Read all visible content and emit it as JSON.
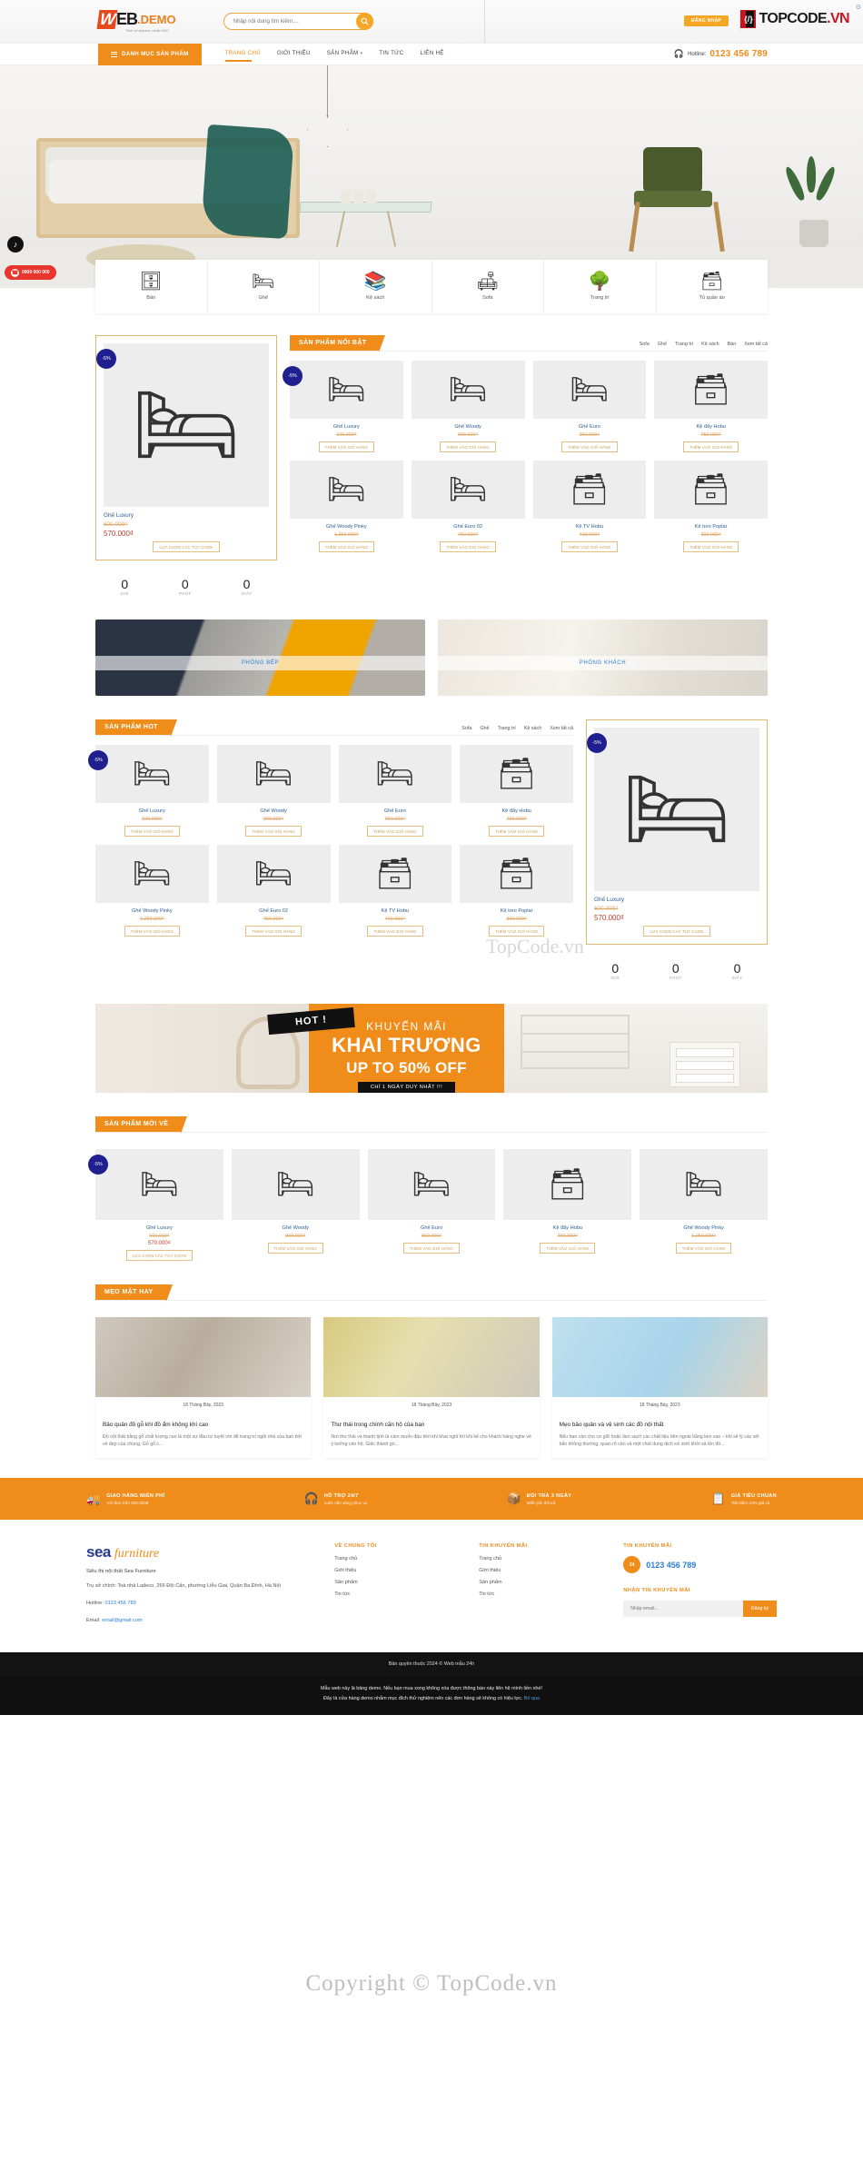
{
  "header": {
    "logo_w": "W",
    "logo_eb": "EB",
    "logo_demo": ".DEMO",
    "logo_sub": "Thiết kế website chuẩn SEO",
    "search_placeholder": "Nhập nội dung tìm kiếm....",
    "search_value": "",
    "login_label": "ĐĂNG NHẬP",
    "partner_brand_mark": "{/}",
    "partner_brand_black": "TOPCODE",
    "partner_brand_red": ".VN"
  },
  "nav": {
    "category_button": "DANH MỤC SẢN PHẨM",
    "links": [
      {
        "label": "TRANG CHỦ",
        "active": true,
        "caret": false
      },
      {
        "label": "GIỚI THIỆU",
        "active": false,
        "caret": false
      },
      {
        "label": "SẢN PHẨM",
        "active": false,
        "caret": true
      },
      {
        "label": "TIN TỨC",
        "active": false,
        "caret": false
      },
      {
        "label": "LIÊN HỆ",
        "active": false,
        "caret": false
      }
    ],
    "hotline_label": "Hotline:",
    "hotline_number": "0123 456 789"
  },
  "side_widgets": {
    "tiktok_icon": "tiktok-icon",
    "phone_number": "0909 000 000"
  },
  "categories": [
    {
      "label": "Bàn",
      "icon": "table-icon",
      "glyph": "🪑"
    },
    {
      "label": "Ghế",
      "icon": "chair-icon",
      "glyph": "🪑"
    },
    {
      "label": "Kệ sách",
      "icon": "bookshelf-icon",
      "glyph": "📚"
    },
    {
      "label": "Sofa",
      "icon": "sofa-icon",
      "glyph": "🛋"
    },
    {
      "label": "Trang trí",
      "icon": "lamp-icon",
      "glyph": "🪴"
    },
    {
      "label": "Tủ quần áo",
      "icon": "wardrobe-icon",
      "glyph": "🚪"
    }
  ],
  "featured_section": {
    "title": "SẢN PHẨM NỔI BẬT",
    "tabs": [
      "Sofa",
      "Ghế",
      "Trang trí",
      "Kệ sách",
      "Bàn",
      "Xem tất cả"
    ],
    "spotlight": {
      "badge": "-5%",
      "name": "Ghế Luxury",
      "old_price": "600.000₫",
      "new_price": "570.000₫",
      "button": "LỰA CHỌN CÁC TÙY CHỌN",
      "glyph": "🪑"
    },
    "countdown": [
      {
        "value": "0",
        "unit": "GIỜ"
      },
      {
        "value": "0",
        "unit": "PHÚT"
      },
      {
        "value": "0",
        "unit": "GIÂY"
      }
    ],
    "products": [
      {
        "name": "Ghế Luxury",
        "price": "600.000₫",
        "badge": "-5%",
        "button": "THÊM VÀO GIỎ HÀNG",
        "glyph": "🪑"
      },
      {
        "name": "Ghế Woody",
        "price": "900.000₫",
        "badge": "",
        "button": "THÊM VÀO GIỎ HÀNG",
        "glyph": "🪑"
      },
      {
        "name": "Ghế Euro",
        "price": "960.000₫",
        "badge": "",
        "button": "THÊM VÀO GIỎ HÀNG",
        "glyph": "🪑"
      },
      {
        "name": "Kệ đẩy Hobu",
        "price": "750.000₫",
        "badge": "",
        "button": "THÊM VÀO GIỎ HÀNG",
        "glyph": "🗄"
      },
      {
        "name": "Ghế Woody Pinky",
        "price": "1.250.000₫",
        "badge": "",
        "button": "THÊM VÀO GIỎ HÀNG",
        "glyph": "🪑"
      },
      {
        "name": "Ghế Euro 02",
        "price": "750.000₫",
        "badge": "",
        "button": "THÊM VÀO GIỎ HÀNG",
        "glyph": "🪑"
      },
      {
        "name": "Kệ TV Hobu",
        "price": "400.000₫",
        "badge": "",
        "button": "THÊM VÀO GIỎ HÀNG",
        "glyph": "🗄"
      },
      {
        "name": "Kệ treo Poplar",
        "price": "300.000₫",
        "badge": "",
        "button": "THÊM VÀO GIỎ HÀNG",
        "glyph": "🗄"
      }
    ]
  },
  "rooms": [
    {
      "label": "PHÒNG BẾP",
      "key": "kitchen"
    },
    {
      "label": "PHÒNG KHÁCH",
      "key": "living"
    }
  ],
  "hot_section": {
    "title": "SẢN PHẨM HOT",
    "tabs": [
      "Sofa",
      "Ghế",
      "Trang trí",
      "Kệ sách",
      "Xem tất cả"
    ],
    "spotlight": {
      "badge": "-5%",
      "name": "Ghế Luxury",
      "old_price": "600.000₫",
      "new_price": "570.000₫",
      "button": "LỰA CHỌN CÁC TÙY CHỌN",
      "glyph": "🪑"
    },
    "countdown": [
      {
        "value": "0",
        "unit": "GIỜ"
      },
      {
        "value": "0",
        "unit": "PHÚT"
      },
      {
        "value": "0",
        "unit": "GIÂY"
      }
    ],
    "products": [
      {
        "name": "Ghế Luxury",
        "price": "600.000₫",
        "badge": "-5%",
        "button": "THÊM VÀO GIỎ HÀNG",
        "glyph": "🪑"
      },
      {
        "name": "Ghế Woody",
        "price": "900.000₫",
        "badge": "",
        "button": "THÊM VÀO GIỎ HÀNG",
        "glyph": "🪑"
      },
      {
        "name": "Ghế Euro",
        "price": "960.000₫",
        "badge": "",
        "button": "THÊM VÀO GIỎ HÀNG",
        "glyph": "🪑"
      },
      {
        "name": "Kệ đẩy Hobu",
        "price": "750.000₫",
        "badge": "",
        "button": "THÊM VÀO GIỎ HÀNG",
        "glyph": "🗄"
      },
      {
        "name": "Ghế Woody Pinky",
        "price": "1.250.000₫",
        "badge": "",
        "button": "THÊM VÀO GIỎ HÀNG",
        "glyph": "🪑"
      },
      {
        "name": "Ghế Euro 02",
        "price": "750.000₫",
        "badge": "",
        "button": "THÊM VÀO GIỎ HÀNG",
        "glyph": "🪑"
      },
      {
        "name": "Kệ TV Hobu",
        "price": "400.000₫",
        "badge": "",
        "button": "THÊM VÀO GIỎ HÀNG",
        "glyph": "🗄"
      },
      {
        "name": "Kệ treo Poplar",
        "price": "300.000₫",
        "badge": "",
        "button": "THÊM VÀO GIỎ HÀNG",
        "glyph": "🗄"
      }
    ]
  },
  "promo_banner": {
    "hot_tag": "HOT !",
    "line1": "KHUYẾN MÃI",
    "line2": "KHAI TRƯƠNG",
    "line3": "UP TO 50% OFF",
    "line4": "CHỈ 1 NGÀY DUY NHẤT !!!"
  },
  "new_section": {
    "title": "SẢN PHẨM MỚI VỀ",
    "products": [
      {
        "name": "Ghế Luxury",
        "old_price": "600.000₫",
        "new_price": "570.000₫",
        "badge": "-5%",
        "button": "LỰA CHỌN CÁC TÙY CHỌN",
        "glyph": "🪑"
      },
      {
        "name": "Ghế Woody",
        "old_price": "",
        "new_price": "900.000₫",
        "badge": "",
        "button": "THÊM VÀO GIỎ HÀNG",
        "glyph": "🪑"
      },
      {
        "name": "Ghế Euro",
        "old_price": "",
        "new_price": "960.000₫",
        "badge": "",
        "button": "THÊM VÀO GIỎ HÀNG",
        "glyph": "🪑"
      },
      {
        "name": "Kệ đẩy Hobu",
        "old_price": "",
        "new_price": "750.000₫",
        "badge": "",
        "button": "THÊM VÀO GIỎ HÀNG",
        "glyph": "🗄"
      },
      {
        "name": "Ghế Woody Pinky",
        "old_price": "",
        "new_price": "1.250.000₫",
        "badge": "",
        "button": "THÊM VÀO GIỎ HÀNG",
        "glyph": "🪑"
      }
    ]
  },
  "blog_section": {
    "title": "MẸO MẶT HAY",
    "posts": [
      {
        "date": "18 Tháng Bảy, 2023",
        "title": "Bảo quản đồ gỗ khi đồ ẩm không khí cao",
        "excerpt": "Đồ nội thất bằng gỗ chất lượng cao là một sự đầu tư tuyệt vời để trang trí ngôi nhà của bạn bởi vẻ đẹp của chúng. Gỗ gỗ c..."
      },
      {
        "date": "18 Tháng Bảy, 2023",
        "title": "Thư thái trong chính căn hộ của bạn",
        "excerpt": "Nơi thư thái và thanh tịnh là cảm muốn đầu tiên khi khai nghĩ tới khi kể cho khách hàng nghe về ý tưởng cản hộ. Giấc thành gri..."
      },
      {
        "date": "18 Tháng Bảy, 2023",
        "title": "Mẹo bảo quản và vệ sinh các đồ nội thất",
        "excerpt": "Nếu bạn cần cho cơ giữ hoặc làm sạch các chất liệu bên ngoài bằng ken xao – khi sẽ lý các vết bẩn không thường, quan rõ cần và một chút dung dịch xử sinh khởi xả lên đồ..."
      }
    ]
  },
  "services": [
    {
      "icon": "truck-icon",
      "glyph": "🚚",
      "title": "GIAO HÀNG MIỄN PHÍ",
      "sub": "Với đơn trên 300.000đ"
    },
    {
      "icon": "headset-icon",
      "glyph": "🎧",
      "title": "HỖ TRỢ 24/7",
      "sub": "Luôn sẵn sàng phục vụ"
    },
    {
      "icon": "box-icon",
      "glyph": "📦",
      "title": "ĐỔI TRẢ 3 NGÀY",
      "sub": "Miễn phí đổi trả"
    },
    {
      "icon": "clipboard-icon",
      "glyph": "📋",
      "title": "GIÁ TIÊU CHUẨN",
      "sub": "Tiết kiệm 10% giá cả"
    }
  ],
  "footer": {
    "brand_sea": "sea",
    "brand_furniture": "furniture",
    "tagline": "Siêu thị nội thất Sea Furniture",
    "address": "Trụ sở chính: Toà nhà Ladeco, 266 Đội Cấn, phường Liễu Giai, Quận Ba Đình, Hà Nội",
    "hotline_label": "Hotline:",
    "hotline_value": "0123 456 789",
    "email_label": "Email:",
    "email_value": "email@gmail.com",
    "col2_heading": "VỀ CHÚNG TÔI",
    "col2_items": [
      "Trang chủ",
      "Giới thiệu",
      "Sản phẩm",
      "Tin tức"
    ],
    "col3_heading": "TIN KHUYẾN MÃI",
    "col3_items": [
      "Trang chủ",
      "Giới thiệu",
      "Sản phẩm",
      "Tin tức"
    ],
    "col4_heading": "TIN KHUYẾN MÃI",
    "col4_badge": "24",
    "col4_phone": "0123 456 789",
    "newsletter_heading": "NHẬN TIN KHUYẾN MÃI",
    "newsletter_placeholder": "Nhập email...",
    "newsletter_value": "",
    "newsletter_button": "Đăng ký"
  },
  "bottom": {
    "copyright": "Bản quyền thuộc 2024 © Web mẫu 24h",
    "demo_line1": "Mẫu web này là bảng demo. Nếu bạn mua xong không xóa được thông báo này liên hệ mình liền nhé!",
    "demo_line2": "Đây là cửa hàng demo nhằm mục đích thử nghiệm nên các đơn hàng sẽ không có hiệu lực.",
    "demo_link": "Bỏ qua"
  },
  "watermark": {
    "main": "Copyright © TopCode.vn",
    "secondary": "TopCode.vn"
  }
}
